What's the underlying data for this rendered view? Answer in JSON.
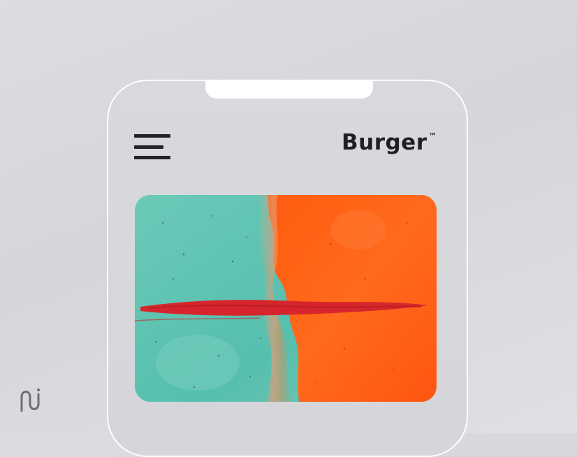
{
  "app": {
    "brand_name": "Burger",
    "brand_mark": "™"
  },
  "header": {
    "menu_icon": "hamburger-menu-icon"
  },
  "hero_image": {
    "description_colors": {
      "left": "#5fc4b3",
      "right": "#ff5a14",
      "stroke": "#d92a2a"
    }
  },
  "corner_logo": {
    "icon": "logo-mark-icon"
  }
}
